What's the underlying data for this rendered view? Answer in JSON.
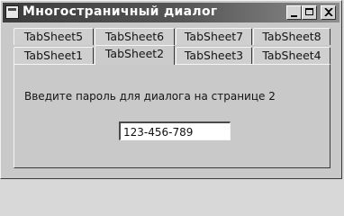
{
  "window": {
    "title": "Многостраничный диалог"
  },
  "tabs_back_row": [
    {
      "label": "TabSheet5"
    },
    {
      "label": "TabSheet6"
    },
    {
      "label": "TabSheet7"
    },
    {
      "label": "TabSheet8"
    }
  ],
  "tabs_front_row": [
    {
      "label": "TabSheet1"
    },
    {
      "label": "TabSheet2"
    },
    {
      "label": "TabSheet3"
    },
    {
      "label": "TabSheet4"
    }
  ],
  "active_tab": "TabSheet2",
  "page": {
    "prompt": "Введите пароль для диалога на странице 2",
    "password_value": "123-456-789"
  },
  "icons": {
    "window_icon": "app-icon",
    "minimize": "minimize-icon",
    "maximize": "maximize-icon",
    "close": "close-icon"
  }
}
